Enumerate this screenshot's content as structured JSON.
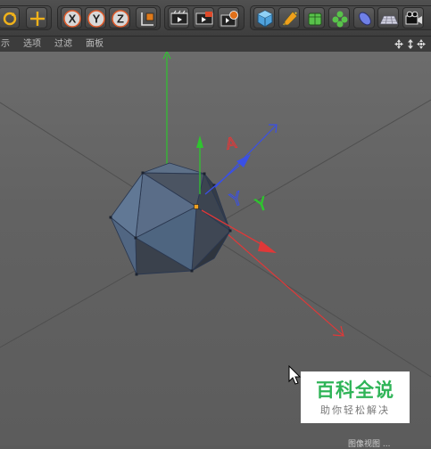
{
  "menu": {
    "items": [
      {
        "id": "show",
        "label": "示"
      },
      {
        "id": "options",
        "label": "选项"
      },
      {
        "id": "filter",
        "label": "过滤"
      },
      {
        "id": "panel",
        "label": "面板"
      }
    ]
  },
  "toolbar": {
    "icons": [
      "rotate-icon",
      "move-icon",
      "x-axis-lock-icon",
      "y-axis-lock-icon",
      "z-axis-lock-icon",
      "coordinate-system-icon",
      "render-view-icon",
      "render-picture-viewer-icon",
      "render-settings-icon",
      "cube-icon",
      "pen-spline-icon",
      "subdivision-icon",
      "mograph-icon",
      "deformer-icon",
      "floor-icon",
      "camera-icon"
    ],
    "axis_labels": {
      "x": "X",
      "y": "Y",
      "z": "Z"
    }
  },
  "viewport": {
    "object": "icosahedron",
    "axis_colors": {
      "x": "#e03838",
      "y": "#2fc42f",
      "z": "#3a50e6"
    },
    "rotation_markers": {
      "x": "A",
      "y": "Y",
      "z": "Y"
    }
  },
  "watermark": {
    "title": "百科全说",
    "subtitle": "助你轻松解决"
  },
  "status": {
    "text": "图像视图 ..."
  }
}
